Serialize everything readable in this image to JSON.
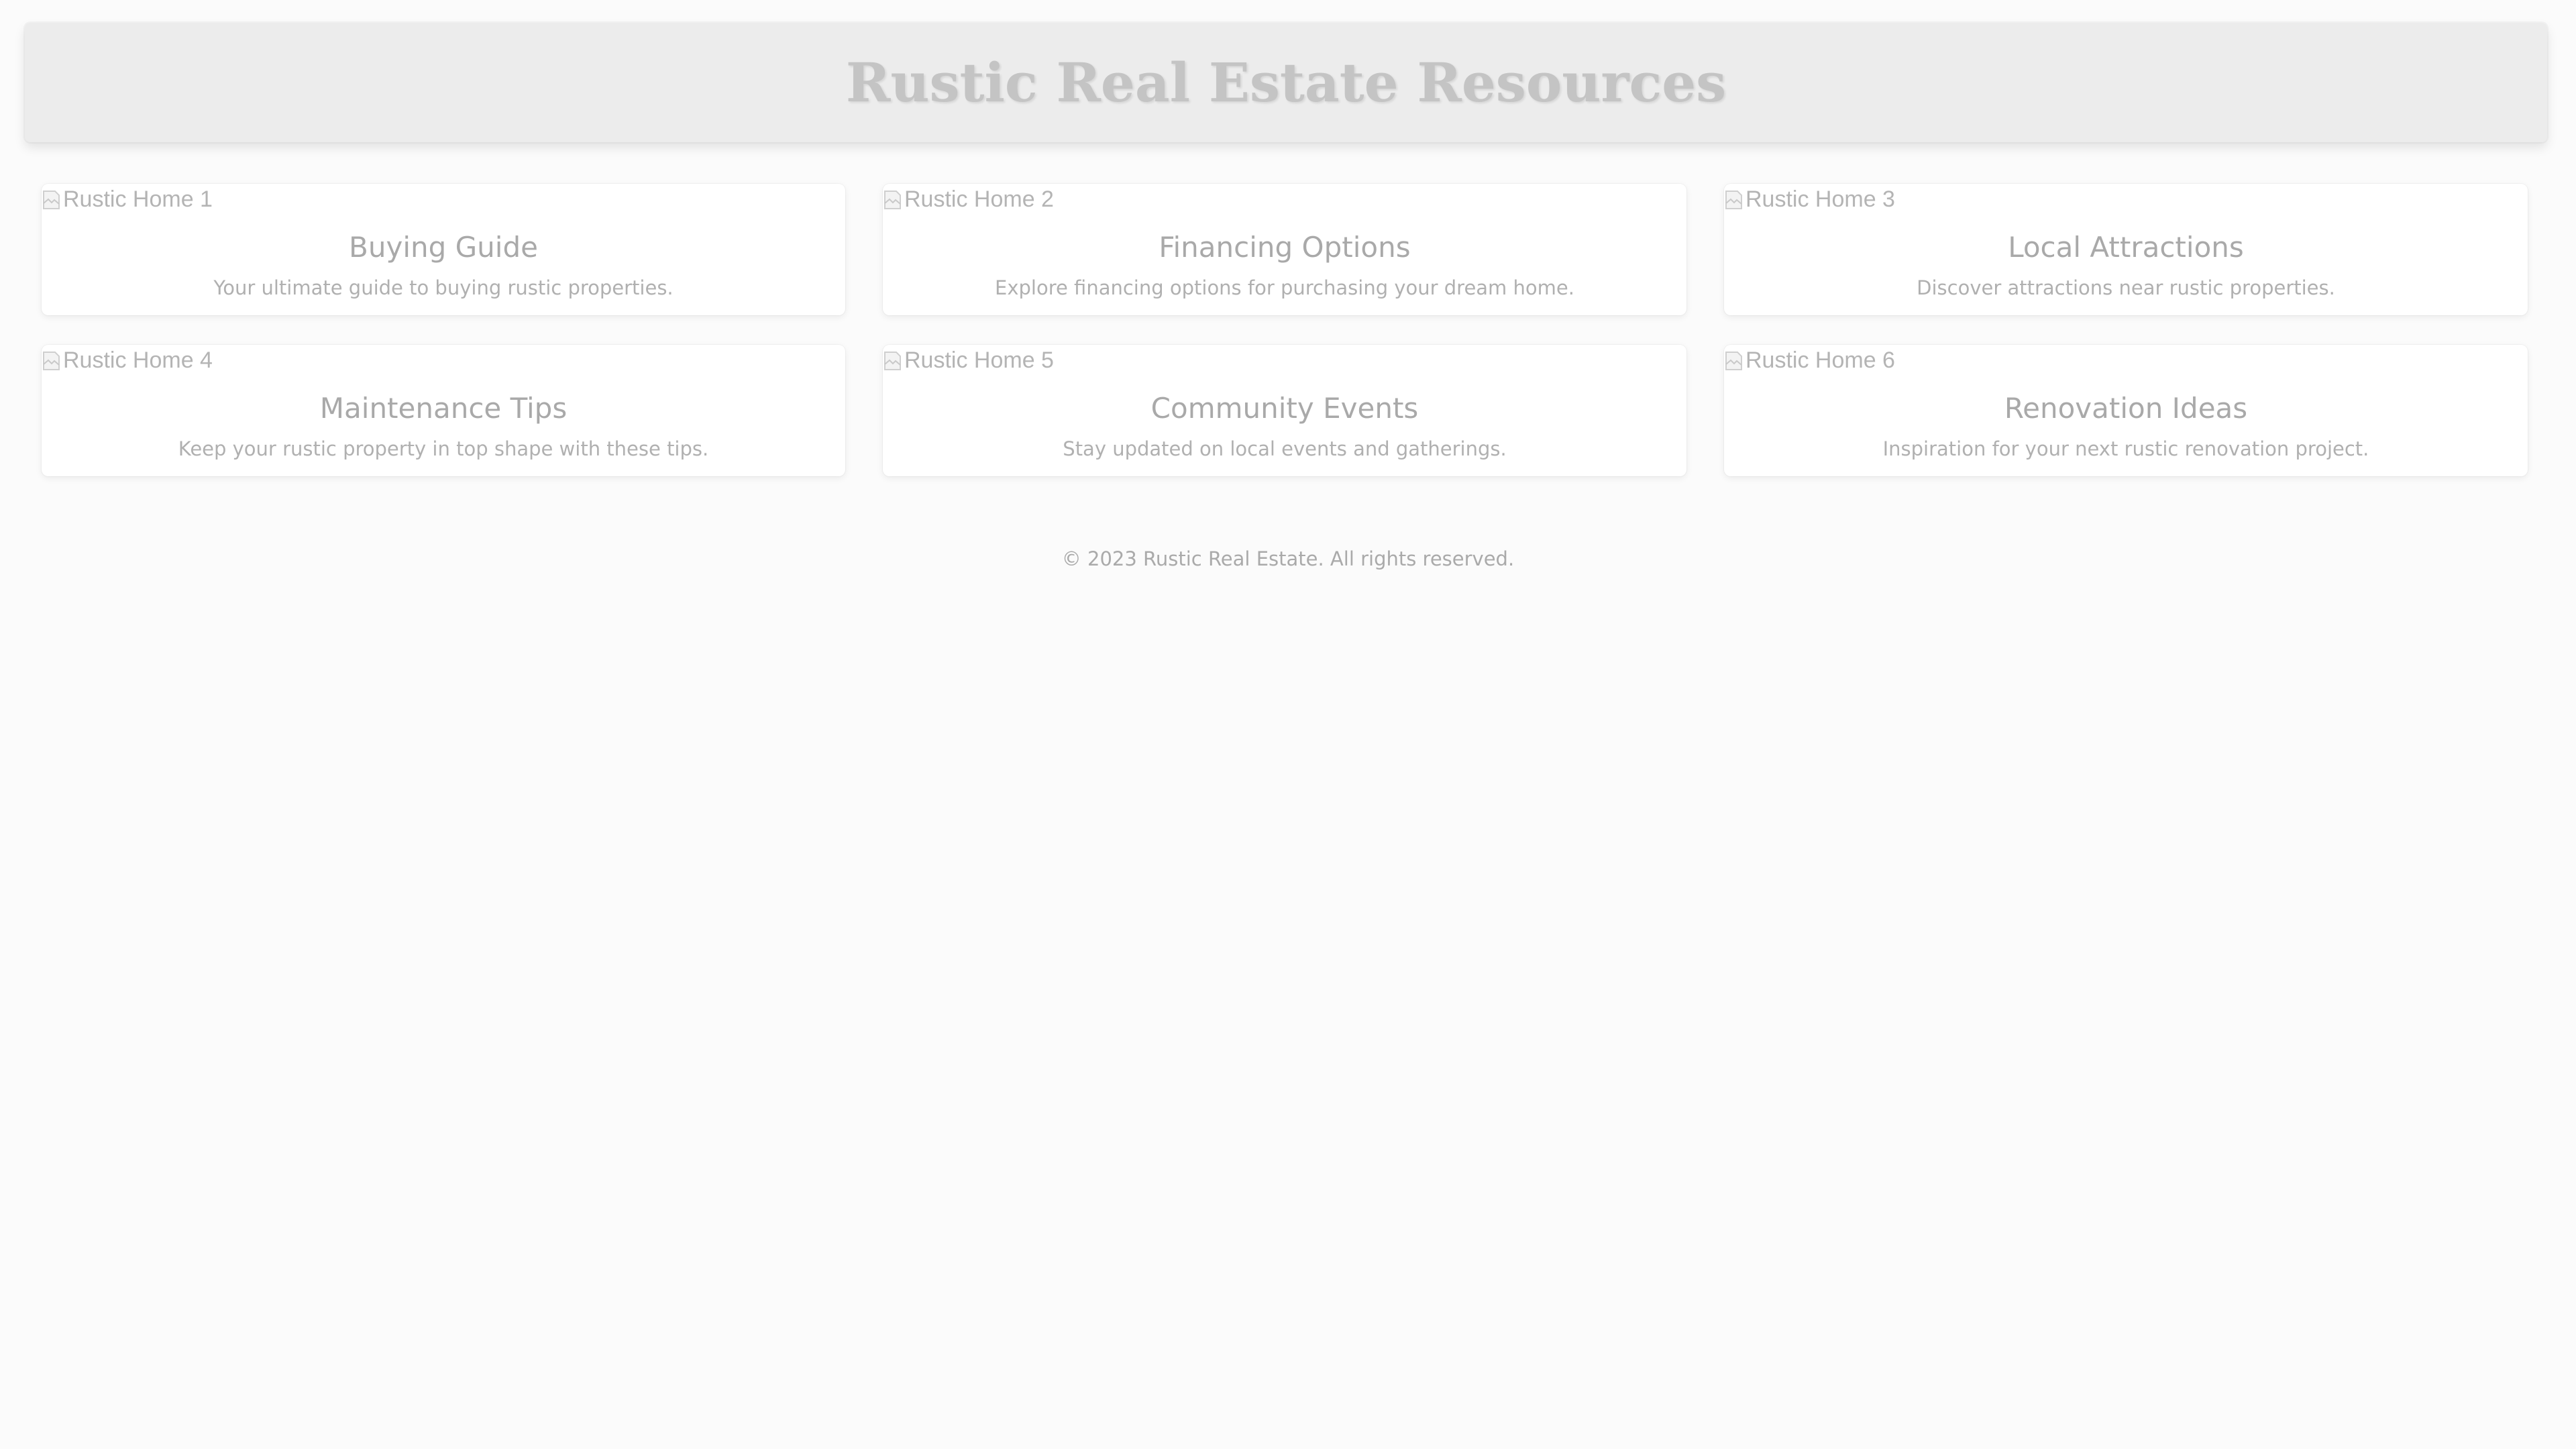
{
  "header": {
    "title": "Rustic Real Estate Resources"
  },
  "cards": [
    {
      "image_alt": "Rustic Home 1",
      "title": "Buying Guide",
      "description": "Your ultimate guide to buying rustic properties."
    },
    {
      "image_alt": "Rustic Home 2",
      "title": "Financing Options",
      "description": "Explore financing options for purchasing your dream home."
    },
    {
      "image_alt": "Rustic Home 3",
      "title": "Local Attractions",
      "description": "Discover attractions near rustic properties."
    },
    {
      "image_alt": "Rustic Home 4",
      "title": "Maintenance Tips",
      "description": "Keep your rustic property in top shape with these tips."
    },
    {
      "image_alt": "Rustic Home 5",
      "title": "Community Events",
      "description": "Stay updated on local events and gatherings."
    },
    {
      "image_alt": "Rustic Home 6",
      "title": "Renovation Ideas",
      "description": "Inspiration for your next rustic renovation project."
    }
  ],
  "footer": {
    "text": "© 2023 Rustic Real Estate. All rights reserved."
  },
  "icons": {
    "broken_image": "broken-image-icon"
  },
  "colors": {
    "background": "#fbfbfb",
    "header_background": "#ececec",
    "title_color": "#c4c4c4",
    "card_background": "#ffffff",
    "text_color": "#a9a9a9"
  }
}
